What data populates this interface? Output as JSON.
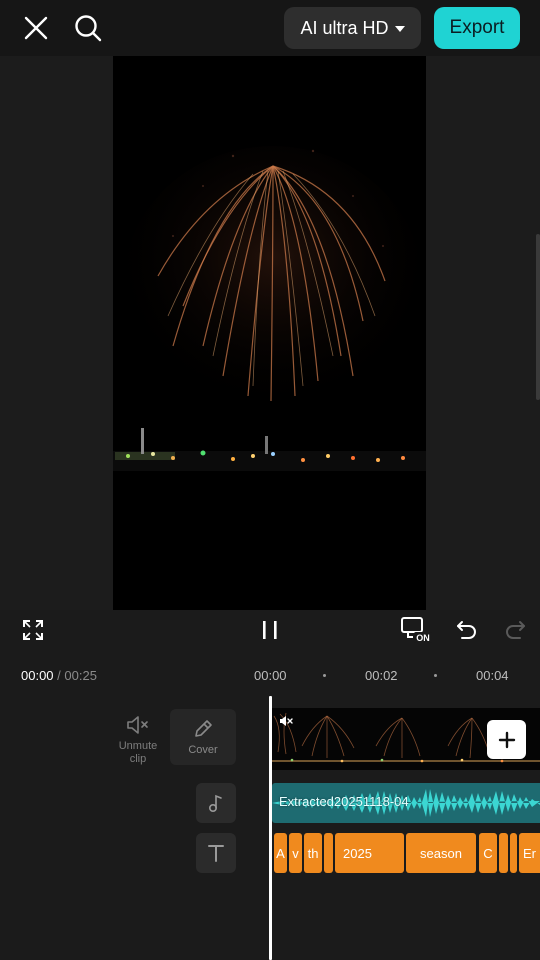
{
  "topbar": {
    "close_icon": "close-icon",
    "search_icon": "search-icon",
    "quality_label": "AI ultra HD",
    "export_label": "Export"
  },
  "controls": {
    "fullscreen_icon": "fullscreen-icon",
    "pause_icon": "pause-icon",
    "on_badge": "ON",
    "undo_icon": "undo-icon",
    "redo_icon": "redo-icon"
  },
  "timeline": {
    "current_time": "00:00",
    "separator": " / ",
    "total_time": "00:25",
    "ticks": [
      "00:00",
      "00:02",
      "00:04"
    ],
    "unmute_label_line1": "Unmute",
    "unmute_label_line2": "clip",
    "cover_label": "Cover",
    "audio_clip_label": "Extracted20251118-04",
    "text_clips": [
      "A",
      "v",
      "th",
      "",
      "2025",
      "season",
      "C",
      "",
      "",
      "Er"
    ]
  },
  "colors": {
    "accent": "#1fd3d3",
    "audio_track": "#1e6b71",
    "text_clip": "#f08a1e"
  }
}
